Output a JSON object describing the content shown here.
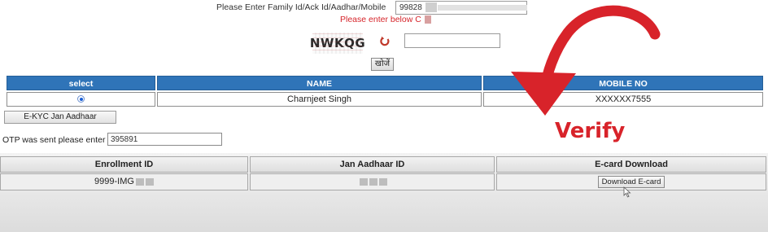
{
  "search_form": {
    "family_label": "Please Enter Family Id/Ack Id/Aadhar/Mobile",
    "family_value": "99828",
    "captcha_message": "Please enter below C",
    "captcha_text": "NWKQG",
    "captcha_input_value": "",
    "search_button": "खोजें"
  },
  "member_table": {
    "headers": [
      "select",
      "NAME",
      "MOBILE NO"
    ],
    "row": {
      "name": "Charnjeet Singh",
      "mobile": "XXXXXX7555"
    }
  },
  "ekyc_button": "E-KYC Jan Aadhaar",
  "otp": {
    "label": "OTP was sent please enter",
    "value": "395891"
  },
  "ecard_table": {
    "headers": [
      "Enrollment ID",
      "Jan Aadhaar ID",
      "E-card Download"
    ],
    "row": {
      "enrollment_id": "9999-IMG",
      "download_button": "Download E-card"
    }
  },
  "overlay": {
    "annotation": "Verify",
    "accent_color": "#d8232a"
  },
  "colors": {
    "table_header_blue": "#2f74b8",
    "annotation_red": "#d8232a"
  }
}
